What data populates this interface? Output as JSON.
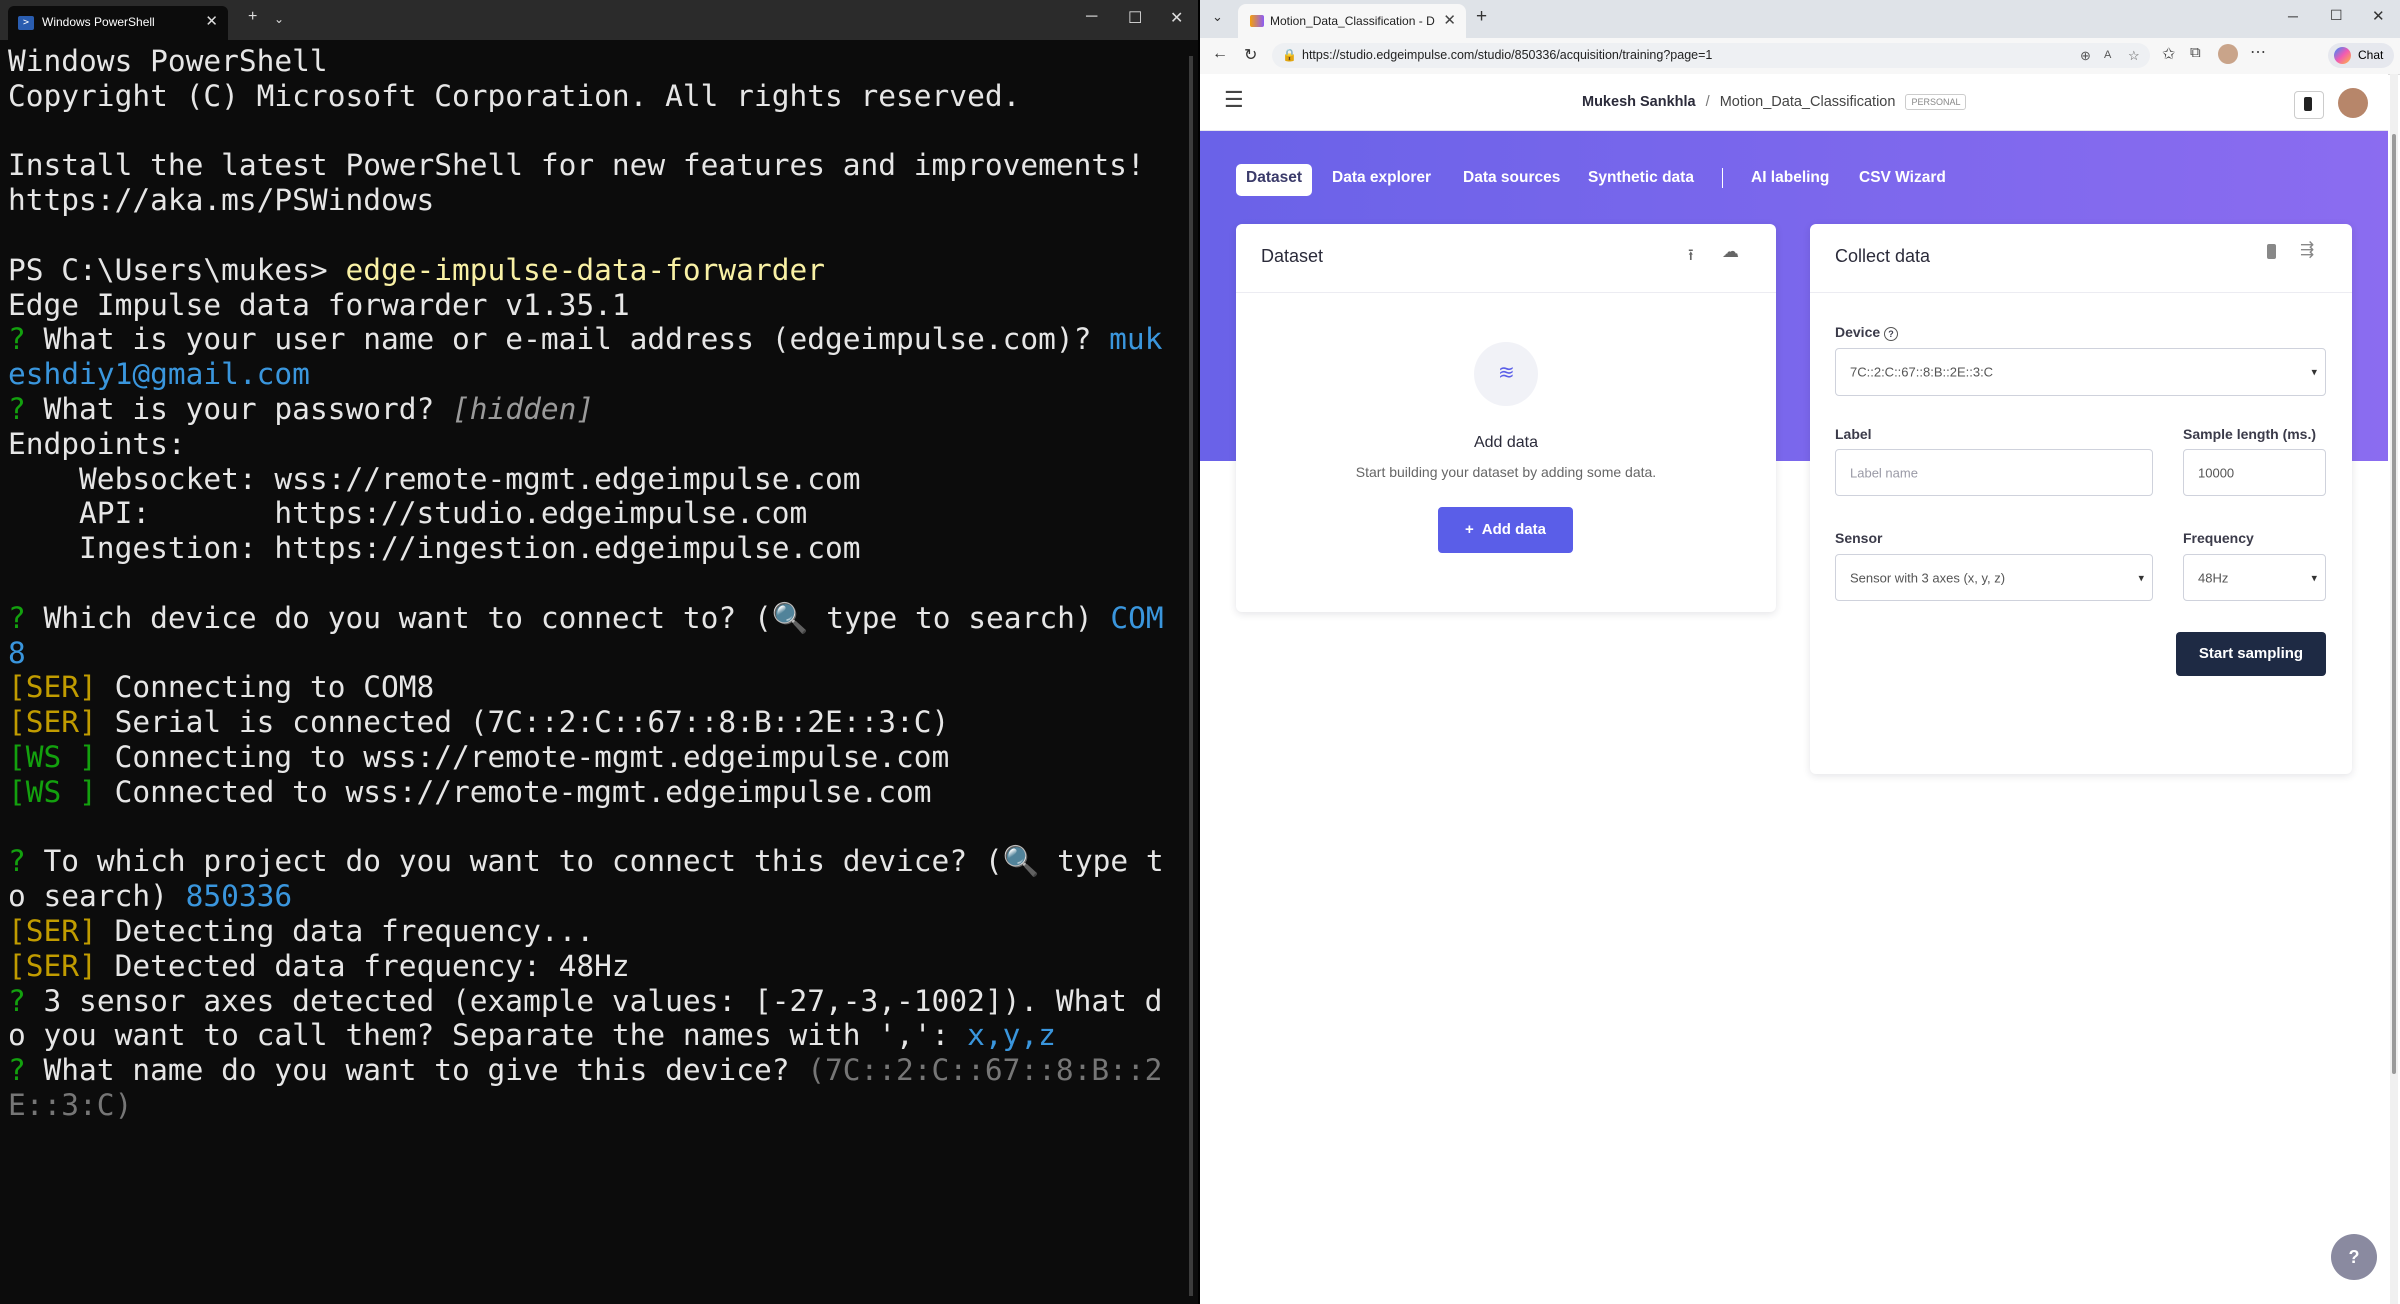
{
  "powershell": {
    "tab_title": "Windows PowerShell",
    "tab_icon": "powershell-icon",
    "lines": [
      {
        "segs": [
          {
            "t": "Windows PowerShell",
            "c": ""
          }
        ]
      },
      {
        "segs": [
          {
            "t": "Copyright (C) Microsoft Corporation. All rights reserved.",
            "c": ""
          }
        ]
      },
      {
        "segs": [
          {
            "t": "",
            "c": ""
          }
        ]
      },
      {
        "segs": [
          {
            "t": "Install the latest PowerShell for new features and improvements!",
            "c": ""
          }
        ]
      },
      {
        "segs": [
          {
            "t": "https://aka.ms/PSWindows",
            "c": ""
          }
        ]
      },
      {
        "segs": [
          {
            "t": "",
            "c": ""
          }
        ]
      },
      {
        "segs": [
          {
            "t": "PS C:\\Users\\mukes> ",
            "c": ""
          },
          {
            "t": "edge-impulse-data-forwarder",
            "c": "y"
          }
        ]
      },
      {
        "segs": [
          {
            "t": "Edge Impulse data forwarder v1.35.1",
            "c": ""
          }
        ]
      },
      {
        "segs": [
          {
            "t": "? ",
            "c": "g"
          },
          {
            "t": "What is your user name or e-mail address (edgeimpulse.com)? ",
            "c": ""
          },
          {
            "t": "muk",
            "c": "c"
          }
        ]
      },
      {
        "segs": [
          {
            "t": "eshdiy1@gmail.com",
            "c": "c"
          }
        ]
      },
      {
        "segs": [
          {
            "t": "? ",
            "c": "g"
          },
          {
            "t": "What is your password? ",
            "c": ""
          },
          {
            "t": "[hidden]",
            "c": "gy"
          }
        ]
      },
      {
        "segs": [
          {
            "t": "Endpoints:",
            "c": ""
          }
        ]
      },
      {
        "segs": [
          {
            "t": "    Websocket: wss://remote-mgmt.edgeimpulse.com",
            "c": ""
          }
        ]
      },
      {
        "segs": [
          {
            "t": "    API:       https://studio.edgeimpulse.com",
            "c": ""
          }
        ]
      },
      {
        "segs": [
          {
            "t": "    Ingestion: https://ingestion.edgeimpulse.com",
            "c": ""
          }
        ]
      },
      {
        "segs": [
          {
            "t": "",
            "c": ""
          }
        ]
      },
      {
        "segs": [
          {
            "t": "? ",
            "c": "g"
          },
          {
            "t": "Which device do you want to connect to? (🔍 type to search) ",
            "c": ""
          },
          {
            "t": "COM",
            "c": "c"
          }
        ]
      },
      {
        "segs": [
          {
            "t": "8",
            "c": "c"
          }
        ]
      },
      {
        "segs": [
          {
            "t": "[SER]",
            "c": "o"
          },
          {
            "t": " Connecting to COM8",
            "c": ""
          }
        ]
      },
      {
        "segs": [
          {
            "t": "[SER]",
            "c": "o"
          },
          {
            "t": " Serial is connected (7C::2:C::67::8:B::2E::3:C)",
            "c": ""
          }
        ]
      },
      {
        "segs": [
          {
            "t": "[WS ]",
            "c": "g"
          },
          {
            "t": " Connecting to wss://remote-mgmt.edgeimpulse.com",
            "c": ""
          }
        ]
      },
      {
        "segs": [
          {
            "t": "[WS ]",
            "c": "g"
          },
          {
            "t": " Connected to wss://remote-mgmt.edgeimpulse.com",
            "c": ""
          }
        ]
      },
      {
        "segs": [
          {
            "t": "",
            "c": ""
          }
        ]
      },
      {
        "segs": [
          {
            "t": "? ",
            "c": "g"
          },
          {
            "t": "To which project do you want to connect this device? (🔍 type t",
            "c": ""
          }
        ]
      },
      {
        "segs": [
          {
            "t": "o search) ",
            "c": ""
          },
          {
            "t": "850336",
            "c": "c"
          }
        ]
      },
      {
        "segs": [
          {
            "t": "[SER]",
            "c": "o"
          },
          {
            "t": " Detecting data frequency...",
            "c": ""
          }
        ]
      },
      {
        "segs": [
          {
            "t": "[SER]",
            "c": "o"
          },
          {
            "t": " Detected data frequency: 48Hz",
            "c": ""
          }
        ]
      },
      {
        "segs": [
          {
            "t": "? ",
            "c": "g"
          },
          {
            "t": "3 sensor axes detected (example values: [-27,-3,-1002]). What d",
            "c": ""
          }
        ]
      },
      {
        "segs": [
          {
            "t": "o you want to call them? Separate the names with ',': ",
            "c": ""
          },
          {
            "t": "x,y,z",
            "c": "c"
          }
        ]
      },
      {
        "segs": [
          {
            "t": "? ",
            "c": "g"
          },
          {
            "t": "What name do you want to give this device? ",
            "c": ""
          },
          {
            "t": "(7C::2:C::67::8:B::2",
            "c": "gr"
          }
        ]
      },
      {
        "segs": [
          {
            "t": "E::3:C)",
            "c": "gr"
          }
        ]
      }
    ]
  },
  "browser": {
    "tab_title": "Motion_Data_Classification - Data",
    "url": "https://studio.edgeimpulse.com/studio/850336/acquisition/training?page=1",
    "chat_label": "Chat",
    "breadcrumb": {
      "user": "Mukesh Sankhla",
      "sep": "/",
      "project": "Motion_Data_Classification",
      "badge": "PERSONAL"
    },
    "subnav": [
      "Dataset",
      "Data explorer",
      "Data sources",
      "Synthetic data",
      "AI labeling",
      "CSV Wizard"
    ],
    "dataset_card": {
      "title": "Dataset",
      "empty_title": "Add data",
      "empty_text": "Start building your dataset by adding some data.",
      "add_button": "Add data"
    },
    "collect_card": {
      "title": "Collect data",
      "device_label": "Device",
      "device_value": "7C::2:C::67::8:B::2E::3:C",
      "label_label": "Label",
      "label_placeholder": "Label name",
      "sample_length_label": "Sample length (ms.)",
      "sample_length_value": "10000",
      "sensor_label": "Sensor",
      "sensor_value": "Sensor with 3 axes (x, y, z)",
      "frequency_label": "Frequency",
      "frequency_value": "48Hz",
      "start_button": "Start sampling"
    },
    "colors": {
      "accent": "#5a5ee8",
      "hero_start": "#6a62e8",
      "hero_end": "#8b6cf0",
      "dark_button": "#1e2a44"
    }
  }
}
